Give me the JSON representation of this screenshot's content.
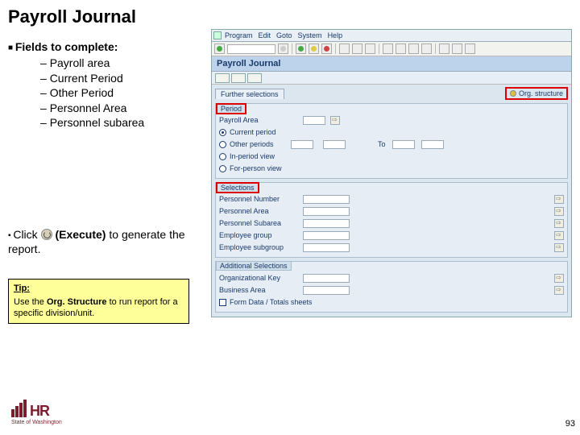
{
  "slide": {
    "title": "Payroll Journal",
    "pagenum": "93"
  },
  "left": {
    "fields_header": "Fields to complete:",
    "fields": [
      "Payroll area",
      "Current Period",
      "Other Period",
      "Personnel Area",
      "Personnel subarea"
    ],
    "click_prefix": "Click ",
    "execute_label": "(Execute)",
    "click_suffix": " to generate the report.",
    "tip_label": "Tip:",
    "tip_prefix": "Use the ",
    "tip_bold": "Org. Structure",
    "tip_suffix": " to run report for a specific division/unit."
  },
  "sap": {
    "menus": [
      "Program",
      "Edit",
      "Goto",
      "System",
      "Help"
    ],
    "screen_title": "Payroll Journal",
    "tabs": {
      "further": "Further selections",
      "org": "Org. structure"
    },
    "groups": {
      "period": {
        "legend": "Period",
        "payroll_area": "Payroll Area",
        "current": "Current period",
        "other": "Other periods",
        "inperson": "In-period view",
        "forperson": "For-person view",
        "to": "To"
      },
      "selections": {
        "legend": "Selections",
        "personnel_number": "Personnel Number",
        "personnel_area": "Personnel Area",
        "personnel_subarea": "Personnel Subarea",
        "employee_group": "Employee group",
        "employee_subgroup": "Employee subgroup"
      },
      "additional": {
        "legend": "Additional Selections",
        "org_key": "Organizational Key",
        "business_area": "Business Area",
        "form_data": "Form Data / Totals sheets"
      }
    }
  },
  "logo": {
    "text": "HR",
    "sub": "State of Washington"
  }
}
